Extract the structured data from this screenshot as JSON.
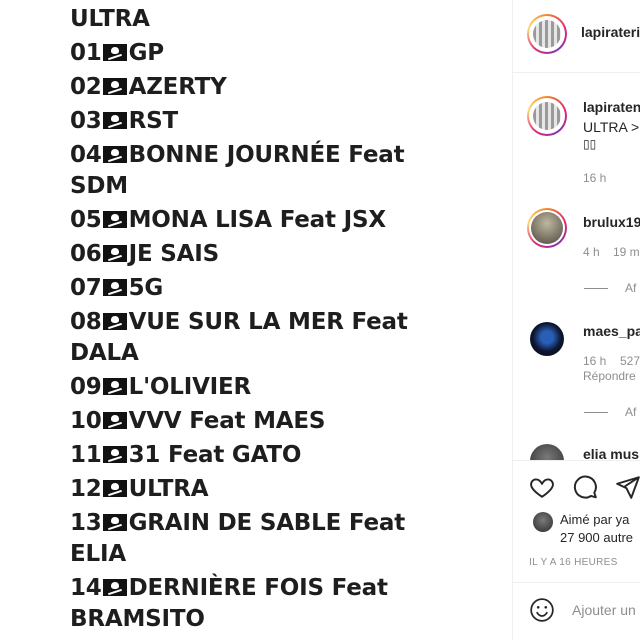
{
  "post": {
    "tracks": [
      "ULTRA",
      "01",
      "02",
      "03",
      "04",
      "05",
      "06",
      "07",
      "08",
      "09",
      "10",
      "11",
      "12",
      "13",
      "14"
    ],
    "titles": [
      "",
      "GP",
      "AZERTY",
      "RST",
      "BONNE JOURNÉE Feat",
      "MONA LISA Feat JSX",
      "JE SAIS",
      "5G",
      "VUE SUR LA MER Feat",
      "L'OLIVIER",
      "VVV Feat MAES",
      "31 Feat GATO",
      "ULTRA",
      "GRAIN DE SABLE Feat",
      "DERNIÈRE FOIS Feat"
    ],
    "continuations": {
      "sdm": "SDM",
      "dala": "DALA",
      "elia": "ELIA",
      "bramsito": "BRAMSITO"
    }
  },
  "header": {
    "username": "lapirateri"
  },
  "caption": {
    "username": "lapiraten",
    "text": "ULTRA >",
    "emoji": "▯▯",
    "time": "16 h"
  },
  "comments": [
    {
      "username": "brulux19",
      "time": "4 h",
      "likes": "19 m"
    },
    {
      "username": "maes_pa",
      "time": "16 h",
      "likes": "527",
      "reply": "Répondre"
    },
    {
      "username": "elia mus"
    }
  ],
  "view_replies": [
    "Af",
    "Af"
  ],
  "actions": {
    "liked_by": "Aimé par ya",
    "likes_count": "27 900 autre",
    "timestamp": "IL Y A 16 HEURES",
    "comment_placeholder": "Ajouter un"
  },
  "colors": {
    "text": "#262626",
    "secondary": "#8e8e8e",
    "divider": "#efefef"
  },
  "icons": [
    "heart-icon",
    "comment-icon",
    "share-icon",
    "emoji-icon",
    "pirate-flag-icon"
  ]
}
